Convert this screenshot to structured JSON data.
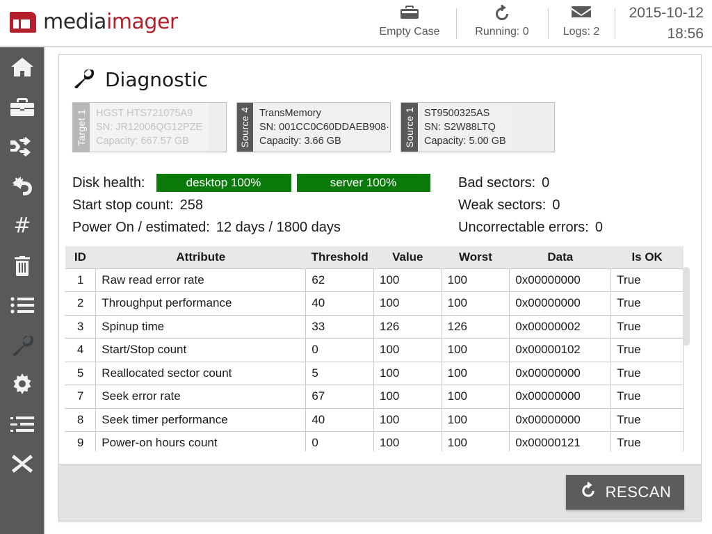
{
  "header": {
    "logo_primary": "media",
    "logo_secondary": "imager",
    "logo_mark_icon": "mediaimager-logo-icon",
    "items": [
      {
        "icon": "briefcase-icon",
        "glyph": "\u0000",
        "label": "Empty Case"
      },
      {
        "icon": "rescan-rotate-icon",
        "glyph": "\u0000",
        "label": "Running: 0"
      },
      {
        "icon": "envelope-icon",
        "glyph": "\u0000",
        "label": "Logs: 2"
      }
    ],
    "date": "2015-10-12",
    "time": "18:56"
  },
  "sidebar": {
    "items": [
      {
        "name": "home",
        "icon": "home-icon",
        "active": false
      },
      {
        "name": "case",
        "icon": "briefcase-icon",
        "active": false
      },
      {
        "name": "transfer",
        "icon": "shuffle-icon",
        "active": false
      },
      {
        "name": "restore",
        "icon": "undo-arrow-icon",
        "active": false
      },
      {
        "name": "hash",
        "icon": "hash-icon",
        "active": false
      },
      {
        "name": "wipe",
        "icon": "trash-icon",
        "active": false
      },
      {
        "name": "list",
        "icon": "list-icon",
        "active": false
      },
      {
        "name": "diagnostic",
        "icon": "wrench-icon",
        "active": true
      },
      {
        "name": "settings",
        "icon": "gear-icon",
        "active": false
      },
      {
        "name": "log",
        "icon": "list-indent-icon",
        "active": false
      },
      {
        "name": "exit",
        "icon": "close-x-icon",
        "active": false
      }
    ]
  },
  "panel": {
    "title": "Diagnostic",
    "title_icon": "wrench-icon"
  },
  "drives": [
    {
      "tab": "Target 1",
      "model": "HGST HTS721075A9",
      "serial": "SN: JR12006QG12PZE",
      "capacity": "Capacity: 667.57 GB",
      "disabled": true
    },
    {
      "tab": "Source 4",
      "model": "TransMemory",
      "serial": "SN: 001CC0C60DDAEB908·",
      "capacity": "Capacity: 3.66 GB",
      "disabled": false
    },
    {
      "tab": "Source 1",
      "model": "ST9500325AS",
      "serial": "SN: S2W88LTQ",
      "capacity": "Capacity: 5.00 GB",
      "disabled": false
    }
  ],
  "stats": {
    "disk_health_label": "Disk health:",
    "health_desktop": "desktop 100%",
    "health_server": "server 100%",
    "health_color": "#0a7a0a",
    "start_stop_label": "Start stop count:",
    "start_stop_value": "258",
    "power_on_label": "Power On / estimated:",
    "power_on_value": "12 days /  1800 days",
    "bad_sectors_label": "Bad sectors:",
    "bad_sectors_value": "0",
    "weak_sectors_label": "Weak sectors:",
    "weak_sectors_value": "0",
    "uncorrectable_label": "Uncorrectable errors:",
    "uncorrectable_value": "0"
  },
  "table": {
    "columns": [
      "ID",
      "Attribute",
      "Threshold",
      "Value",
      "Worst",
      "Data",
      "Is OK"
    ],
    "rows": [
      {
        "id": "1",
        "attribute": "Raw read error rate",
        "threshold": "62",
        "value": "100",
        "worst": "100",
        "data": "0x00000000",
        "is_ok": "True"
      },
      {
        "id": "2",
        "attribute": "Throughput performance",
        "threshold": "40",
        "value": "100",
        "worst": "100",
        "data": "0x00000000",
        "is_ok": "True"
      },
      {
        "id": "3",
        "attribute": "Spinup time",
        "threshold": "33",
        "value": "126",
        "worst": "126",
        "data": "0x00000002",
        "is_ok": "True"
      },
      {
        "id": "4",
        "attribute": "Start/Stop count",
        "threshold": "0",
        "value": "100",
        "worst": "100",
        "data": "0x00000102",
        "is_ok": "True"
      },
      {
        "id": "5",
        "attribute": "Reallocated sector count",
        "threshold": "5",
        "value": "100",
        "worst": "100",
        "data": "0x00000000",
        "is_ok": "True"
      },
      {
        "id": "7",
        "attribute": "Seek error rate",
        "threshold": "67",
        "value": "100",
        "worst": "100",
        "data": "0x00000000",
        "is_ok": "True"
      },
      {
        "id": "8",
        "attribute": "Seek timer performance",
        "threshold": "40",
        "value": "100",
        "worst": "100",
        "data": "0x00000000",
        "is_ok": "True"
      },
      {
        "id": "9",
        "attribute": "Power-on hours count",
        "threshold": "0",
        "value": "100",
        "worst": "100",
        "data": "0x00000121",
        "is_ok": "True"
      },
      {
        "id": "",
        "attribute": "",
        "threshold": "",
        "value": "",
        "worst": "",
        "data": "",
        "is_ok": ""
      }
    ]
  },
  "footer": {
    "rescan_label": "RESCAN",
    "rescan_icon": "rescan-rotate-icon"
  }
}
